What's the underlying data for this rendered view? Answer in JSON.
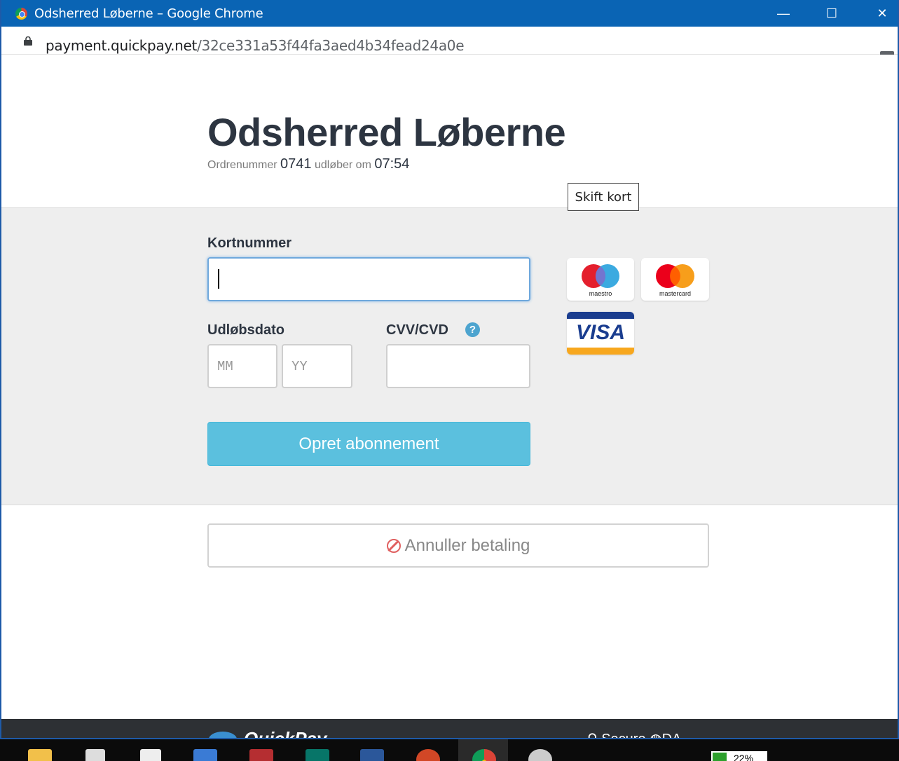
{
  "window": {
    "title": "Odsherred Løberne – Google Chrome",
    "minimize_glyph": "—",
    "maximize_glyph": "☐",
    "close_glyph": "✕"
  },
  "address": {
    "host": "payment.quickpay.net",
    "path": "/32ce331a53f44fa3aed4b34fead24a0e"
  },
  "header": {
    "merchant": "Odsherred Løberne",
    "order_label": "Ordrenummer",
    "order_number": "0741",
    "expires_label": "udløber om",
    "expires_value": "07:54",
    "tooltip": "Skift kort"
  },
  "form": {
    "card_label": "Kortnummer",
    "card_value": "",
    "expiry_label": "Udløbsdato",
    "mm_placeholder": "MM",
    "yy_placeholder": "YY",
    "cvv_label": "CVV/CVD",
    "help_glyph": "?",
    "submit_label": "Opret abonnement"
  },
  "card_logos": {
    "maestro_caption": "maestro",
    "mastercard_caption": "mastercard",
    "visa_word": "VISA"
  },
  "cancel": {
    "label": "Annuller betaling"
  },
  "footer": {
    "brand": "QuickPay",
    "secure_text": "Secure",
    "language": "DA"
  },
  "taskbar": {
    "battery_text": "22%"
  },
  "colors": {
    "titlebar": "#0a64b4",
    "submit": "#5bc0de",
    "help": "#4da4cf",
    "cancel_icon": "#e06060"
  }
}
